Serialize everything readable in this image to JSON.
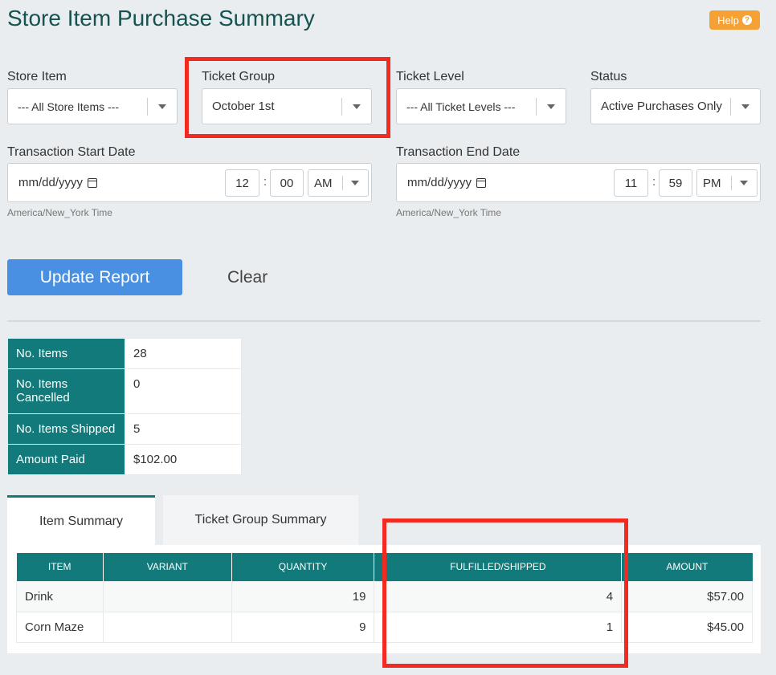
{
  "page": {
    "title": "Store Item Purchase Summary",
    "help_label": "Help"
  },
  "filters": {
    "store_item": {
      "label": "Store Item",
      "value": "--- All Store Items ---"
    },
    "ticket_group": {
      "label": "Ticket Group",
      "value": "October 1st"
    },
    "ticket_level": {
      "label": "Ticket Level",
      "value": "--- All Ticket Levels ---"
    },
    "status": {
      "label": "Status",
      "value": "Active Purchases Only"
    },
    "start": {
      "label": "Transaction Start Date",
      "date_placeholder": "mm/dd/yyyy",
      "hour": "12",
      "minute": "00",
      "ampm": "AM",
      "timezone": "America/New_York Time"
    },
    "end": {
      "label": "Transaction End Date",
      "date_placeholder": "mm/dd/yyyy",
      "hour": "11",
      "minute": "59",
      "ampm": "PM",
      "timezone": "America/New_York Time"
    }
  },
  "actions": {
    "update_label": "Update Report",
    "clear_label": "Clear"
  },
  "stats": [
    {
      "label": "No. Items",
      "value": "28"
    },
    {
      "label": "No. Items Cancelled",
      "value": "0"
    },
    {
      "label": "No. Items Shipped",
      "value": "5"
    },
    {
      "label": "Amount Paid",
      "value": "$102.00"
    }
  ],
  "tabs": [
    {
      "label": "Item Summary",
      "active": true
    },
    {
      "label": "Ticket Group Summary",
      "active": false
    }
  ],
  "table": {
    "headers": [
      "ITEM",
      "VARIANT",
      "QUANTITY",
      "FULFILLED/SHIPPED",
      "AMOUNT"
    ],
    "rows": [
      {
        "item": "Drink",
        "variant": "",
        "quantity": "19",
        "fulfilled": "4",
        "amount": "$57.00"
      },
      {
        "item": "Corn Maze",
        "variant": "",
        "quantity": "9",
        "fulfilled": "1",
        "amount": "$45.00"
      }
    ]
  },
  "colors": {
    "teal": "#127a7a",
    "title": "#16524f",
    "button_blue": "#4a90e2",
    "help_orange": "#f5a133",
    "highlight_red": "#f22b22"
  }
}
